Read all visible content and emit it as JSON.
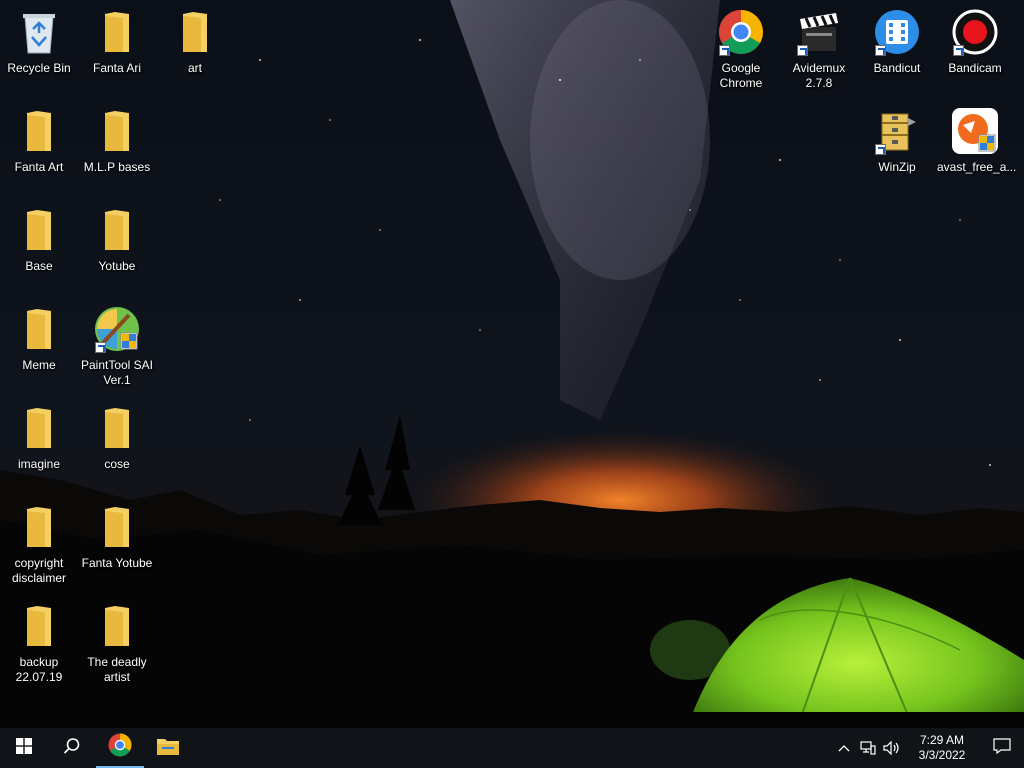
{
  "desktop": {
    "left_icons": [
      {
        "label": "Recycle Bin",
        "icon": "recycle-bin-icon"
      },
      {
        "label": "Fanta Ari",
        "icon": "folder-icon"
      },
      {
        "label": "art",
        "icon": "folder-icon"
      },
      {
        "label": "Fanta Art",
        "icon": "folder-icon"
      },
      {
        "label": "M.L.P bases",
        "icon": "folder-icon"
      },
      {
        "label": "Base",
        "icon": "folder-icon"
      },
      {
        "label": "Yotube",
        "icon": "folder-icon"
      },
      {
        "label": "Meme",
        "icon": "folder-icon"
      },
      {
        "label": "PaintTool SAI Ver.1",
        "icon": "painttool-sai-icon"
      },
      {
        "label": "imagine",
        "icon": "folder-icon"
      },
      {
        "label": "cose",
        "icon": "folder-icon"
      },
      {
        "label": "copyright disclaimer",
        "icon": "folder-icon"
      },
      {
        "label": "Fanta Yotube",
        "icon": "folder-icon"
      },
      {
        "label": "backup 22.07.19",
        "icon": "folder-icon"
      },
      {
        "label": "The deadly artist",
        "icon": "folder-icon"
      }
    ],
    "right_icons": [
      {
        "label": "Google Chrome",
        "icon": "chrome-icon"
      },
      {
        "label": "Avidemux 2.7.8",
        "icon": "avidemux-icon"
      },
      {
        "label": "Bandicut",
        "icon": "bandicut-icon"
      },
      {
        "label": "Bandicam",
        "icon": "bandicam-icon"
      },
      {
        "label": "WinZip",
        "icon": "winzip-icon"
      },
      {
        "label": "avast_free_a...",
        "icon": "avast-icon"
      }
    ]
  },
  "taskbar": {
    "buttons": [
      {
        "icon": "windows-start-icon"
      },
      {
        "icon": "search-icon"
      },
      {
        "icon": "chrome-icon"
      },
      {
        "icon": "file-explorer-icon"
      }
    ],
    "tray": {
      "time": "7:29 AM",
      "date": "3/3/2022",
      "icons": [
        "chevron-up-icon",
        "network-icon",
        "volume-icon",
        "notification-icon"
      ]
    }
  },
  "colors": {
    "taskbar_bg": "#101419",
    "folder_yellow": "#f4cf62",
    "tent_green": "#7ed321",
    "horizon_orange": "#e2631b"
  }
}
